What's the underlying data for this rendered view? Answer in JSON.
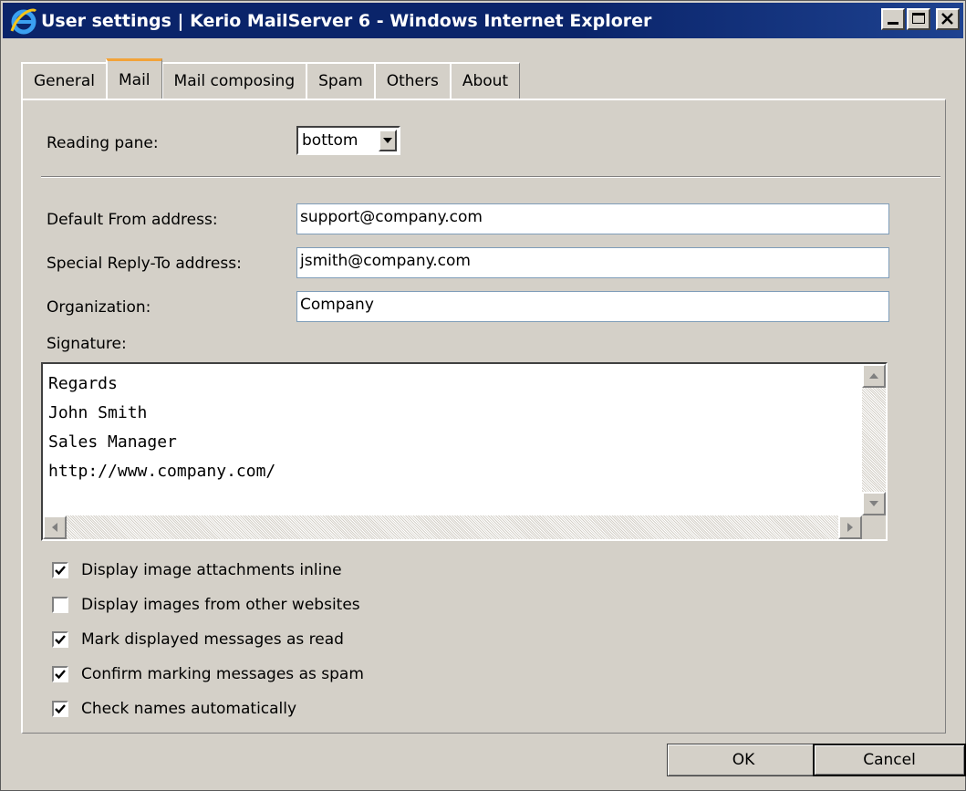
{
  "window": {
    "title": "User settings | Kerio MailServer 6 - Windows Internet Explorer"
  },
  "tabs": [
    {
      "label": "General"
    },
    {
      "label": "Mail",
      "active": true
    },
    {
      "label": "Mail composing"
    },
    {
      "label": "Spam"
    },
    {
      "label": "Others"
    },
    {
      "label": "About"
    }
  ],
  "form": {
    "reading_pane_label": "Reading pane:",
    "reading_pane_value": "bottom",
    "from_label": "Default From address:",
    "from_value": "support@company.com",
    "reply_label": "Special Reply-To address:",
    "reply_value": "jsmith@company.com",
    "org_label": "Organization:",
    "org_value": "Company",
    "signature_label": "Signature:",
    "signature_text": "Regards\nJohn Smith\nSales Manager\nhttp://www.company.com/"
  },
  "options": [
    {
      "label": "Display image attachments inline",
      "checked": true
    },
    {
      "label": "Display images from other websites",
      "checked": false
    },
    {
      "label": "Mark displayed messages as read",
      "checked": true
    },
    {
      "label": "Confirm marking messages as spam",
      "checked": true
    },
    {
      "label": "Check names automatically",
      "checked": true
    }
  ],
  "buttons": {
    "ok": "OK",
    "cancel": "Cancel"
  },
  "icons": {
    "app": "internet-explorer-icon",
    "minimize": "minimize-icon",
    "maximize": "maximize-icon",
    "close": "close-icon"
  }
}
